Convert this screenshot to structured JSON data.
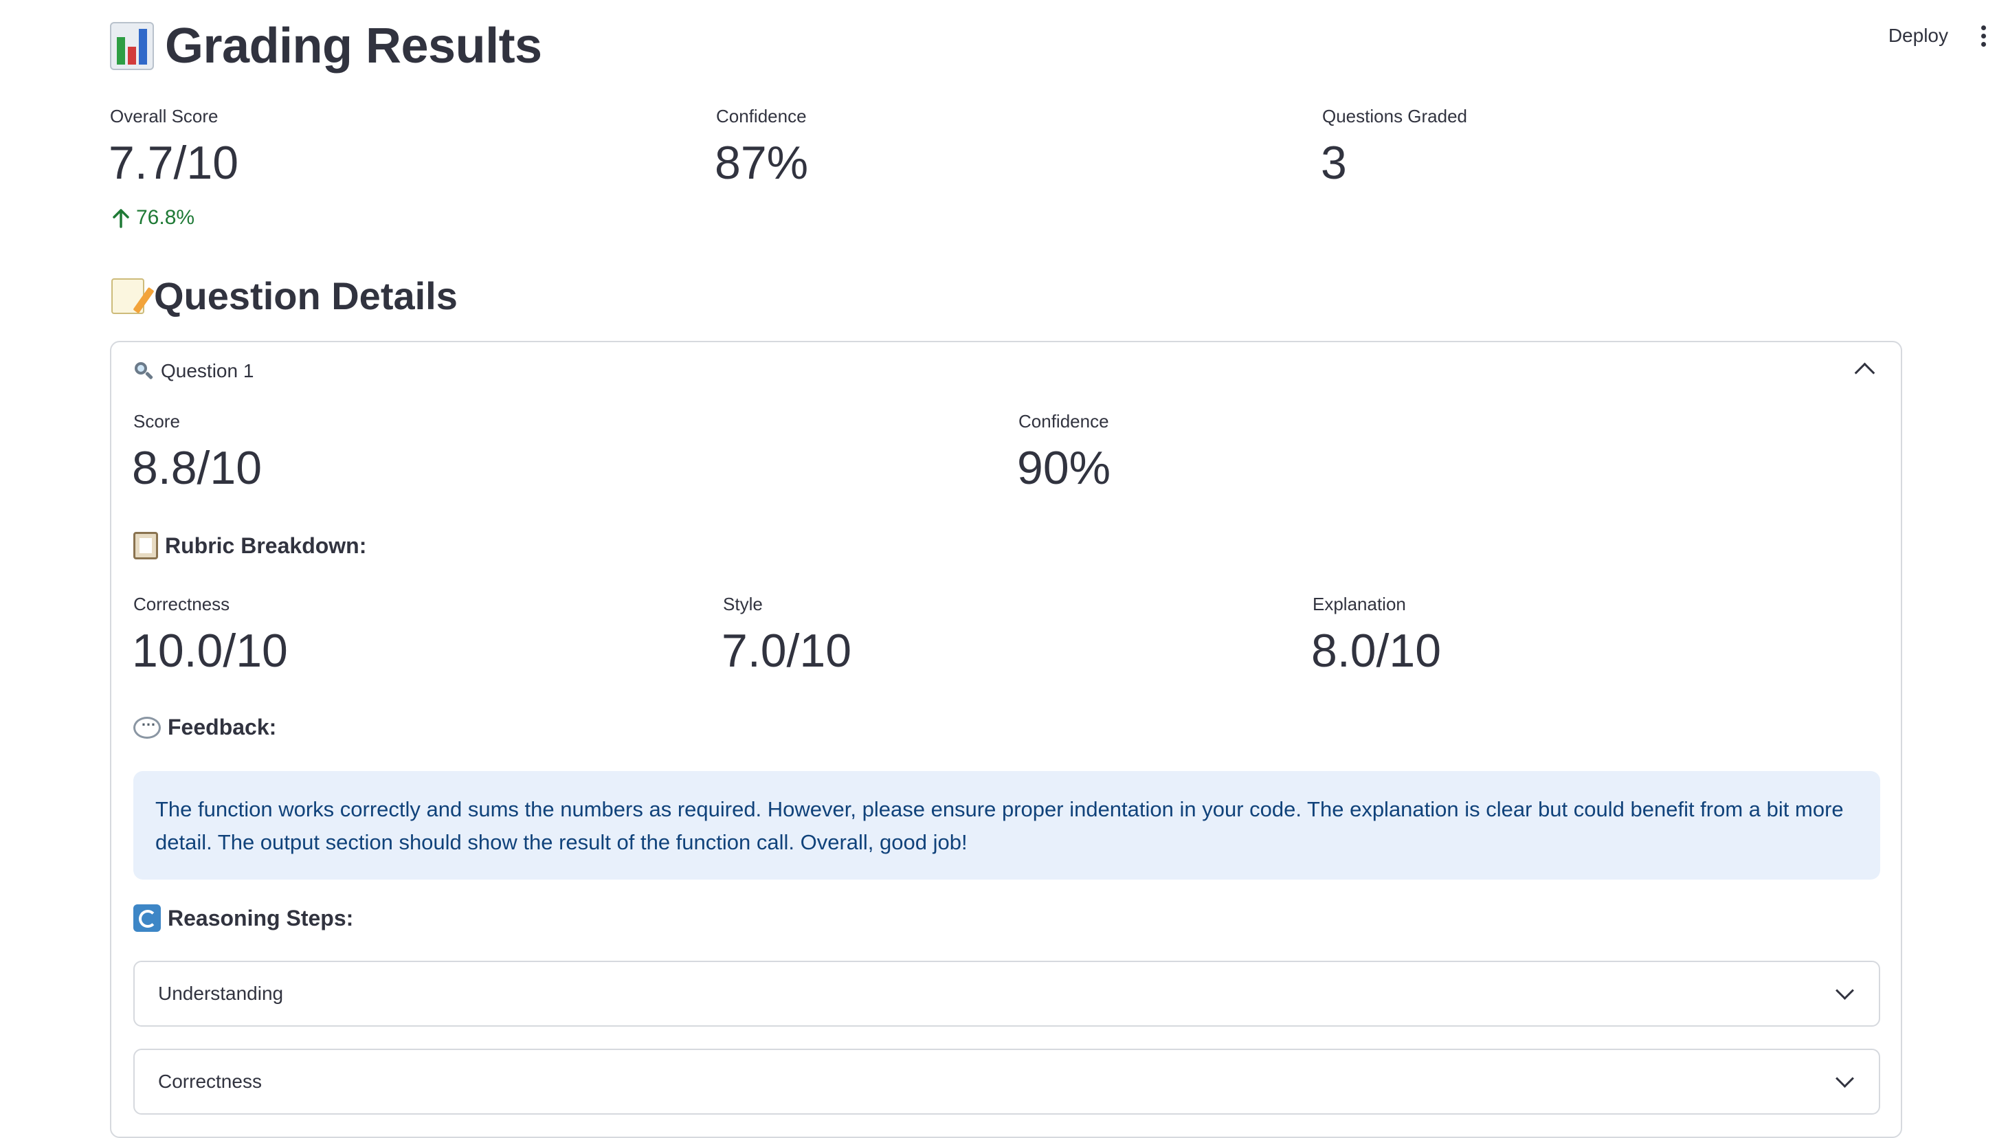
{
  "toolbar": {
    "deploy_label": "Deploy"
  },
  "page": {
    "title": "Grading Results",
    "title_icon": "bar-chart-icon"
  },
  "summary": {
    "overall_score_label": "Overall Score",
    "overall_score_value": "7.7/10",
    "overall_score_delta": "76.8%",
    "confidence_label": "Confidence",
    "confidence_value": "87%",
    "questions_graded_label": "Questions Graded",
    "questions_graded_value": "3"
  },
  "details": {
    "heading": "Question Details",
    "heading_icon": "memo-icon",
    "question": {
      "label": "Question 1",
      "score_label": "Score",
      "score_value": "8.8/10",
      "confidence_label": "Confidence",
      "confidence_value": "90%",
      "rubric_heading": "Rubric Breakdown:",
      "rubric": [
        {
          "label": "Correctness",
          "value": "10.0/10"
        },
        {
          "label": "Style",
          "value": "7.0/10"
        },
        {
          "label": "Explanation",
          "value": "8.0/10"
        }
      ],
      "feedback_heading": "Feedback:",
      "feedback_text": "The function works correctly and sums the numbers as required. However, please ensure proper indentation in your code. The explanation is clear but could benefit from a bit more detail. The output section should show the result of the function call. Overall, good job!",
      "reasoning_heading": "Reasoning Steps:",
      "reasoning_steps": [
        {
          "label": "Understanding"
        },
        {
          "label": "Correctness"
        }
      ]
    }
  },
  "colors": {
    "delta_positive": "#1f7a36",
    "info_bg": "#e8f0fb",
    "info_text": "#10427a"
  }
}
